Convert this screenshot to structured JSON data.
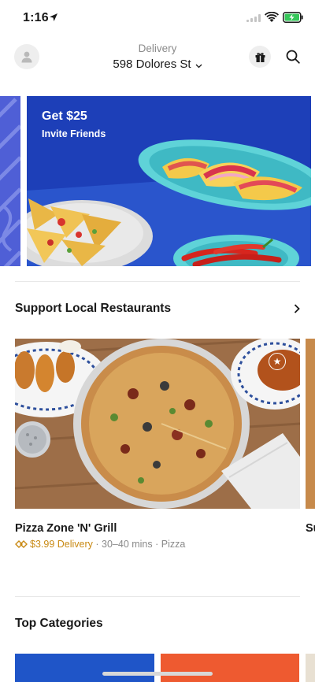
{
  "status_bar": {
    "time": "1:16"
  },
  "header": {
    "mode_label": "Delivery",
    "address": "598 Dolores St"
  },
  "promo": {
    "title": "Get $25",
    "subtitle": "Invite Friends",
    "colors": {
      "card": "#1d3fb8",
      "left_card": "#4f5fd6"
    }
  },
  "sections": {
    "local": {
      "title": "Support Local Restaurants"
    },
    "categories": {
      "title": "Top Categories"
    }
  },
  "store": {
    "name": "Pizza Zone 'N' Grill",
    "delivery_fee": "$3.99 Delivery",
    "details": " · 30–40 mins · Pizza"
  },
  "next_store": {
    "name_prefix": "Su"
  },
  "accent_colors": {
    "fee": "#c98a14",
    "category_blue": "#1f55c8",
    "category_orange": "#ee5a30"
  }
}
